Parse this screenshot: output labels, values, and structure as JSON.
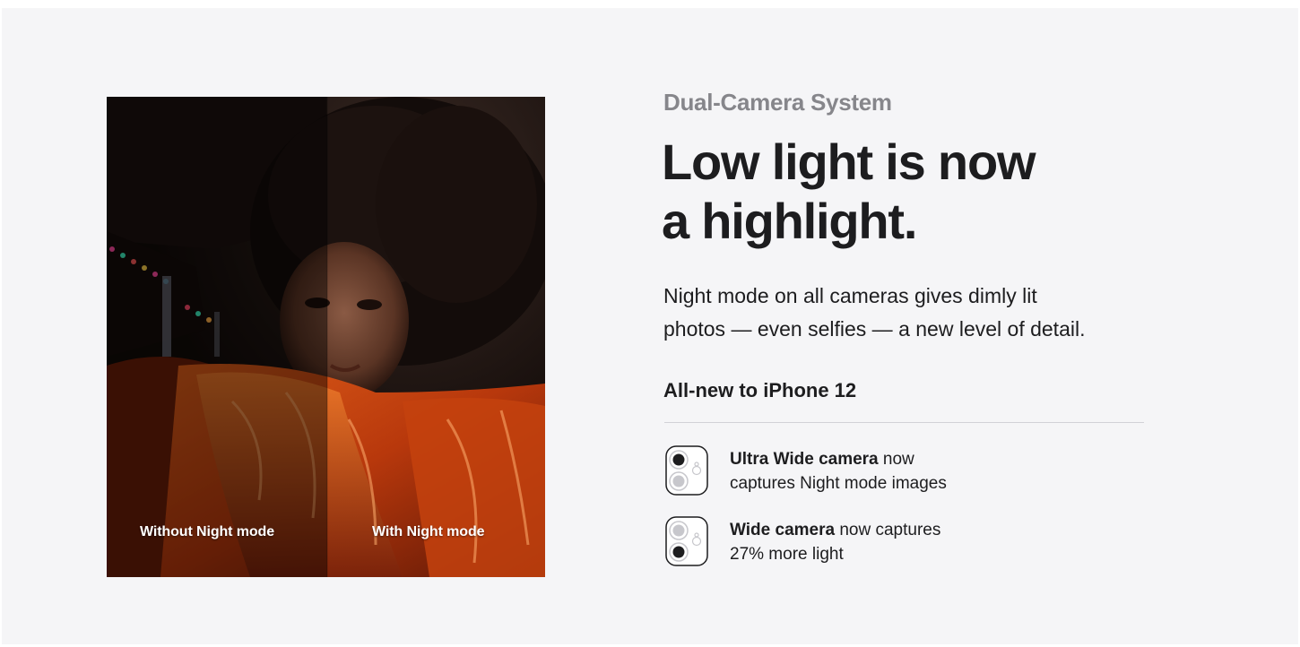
{
  "photo": {
    "label_without": "Without Night mode",
    "label_with": "With Night mode"
  },
  "eyebrow": "Dual-Camera System",
  "headline": {
    "line1": "Low light is now",
    "line2": "a highlight."
  },
  "body": {
    "line1": "Night mode on all cameras gives dimly lit",
    "line2": "photos — even selfies — a new level of detail."
  },
  "subheading": "All-new to iPhone 12",
  "features": [
    {
      "icon": "ultra-wide-camera-icon",
      "bold": "Ultra Wide camera",
      "rest_line1": " now",
      "line2": "captures Night mode images"
    },
    {
      "icon": "wide-camera-icon",
      "bold": "Wide camera",
      "rest_line1": " now captures",
      "line2": "27% more light"
    }
  ],
  "colors": {
    "panel_background": "#f5f5f7",
    "eyebrow": "#86868b",
    "text": "#1d1d1f",
    "divider": "#d2d2d7"
  }
}
